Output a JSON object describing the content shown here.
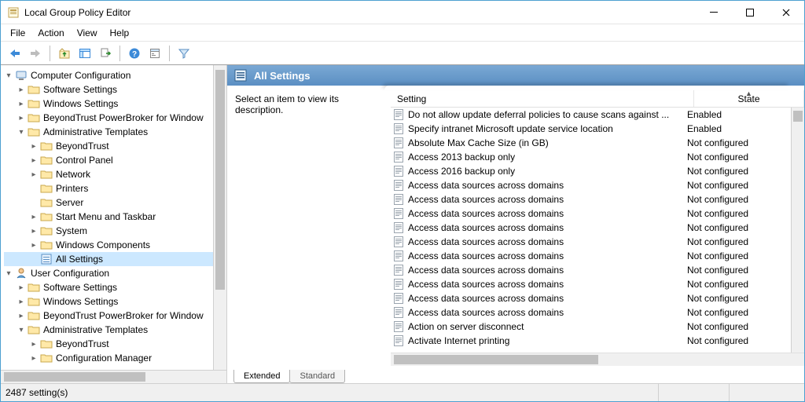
{
  "window": {
    "title": "Local Group Policy Editor"
  },
  "menu": {
    "file": "File",
    "action": "Action",
    "view": "View",
    "help": "Help"
  },
  "pane": {
    "title": "All Settings",
    "description_prompt": "Select an item to view its description."
  },
  "columns": {
    "setting": "Setting",
    "state": "State"
  },
  "tabs": {
    "extended": "Extended",
    "standard": "Standard"
  },
  "status": {
    "count": "2487 setting(s)"
  },
  "tree": {
    "cc": "Computer Configuration",
    "cc_children": {
      "software": "Software Settings",
      "windows": "Windows Settings",
      "beyondtrust_pb": "BeyondTrust PowerBroker for Window",
      "admin": "Administrative Templates",
      "admin_children": {
        "beyondtrust": "BeyondTrust",
        "control_panel": "Control Panel",
        "network": "Network",
        "printers": "Printers",
        "server": "Server",
        "startmenu": "Start Menu and Taskbar",
        "system": "System",
        "wincomp": "Windows Components",
        "allsettings": "All Settings"
      }
    },
    "uc": "User Configuration",
    "uc_children": {
      "software": "Software Settings",
      "windows": "Windows Settings",
      "beyondtrust_pb": "BeyondTrust PowerBroker for Window",
      "admin": "Administrative Templates",
      "admin_children": {
        "beyondtrust": "BeyondTrust",
        "confmgr": "Configuration Manager"
      }
    }
  },
  "list": [
    {
      "name": "Do not allow update deferral policies to cause scans against ...",
      "state": "Enabled"
    },
    {
      "name": "Specify intranet Microsoft update service location",
      "state": "Enabled"
    },
    {
      "name": "Absolute Max Cache Size (in GB)",
      "state": "Not configured"
    },
    {
      "name": "Access 2013 backup only",
      "state": "Not configured"
    },
    {
      "name": "Access 2016 backup only",
      "state": "Not configured"
    },
    {
      "name": "Access data sources across domains",
      "state": "Not configured"
    },
    {
      "name": "Access data sources across domains",
      "state": "Not configured"
    },
    {
      "name": "Access data sources across domains",
      "state": "Not configured"
    },
    {
      "name": "Access data sources across domains",
      "state": "Not configured"
    },
    {
      "name": "Access data sources across domains",
      "state": "Not configured"
    },
    {
      "name": "Access data sources across domains",
      "state": "Not configured"
    },
    {
      "name": "Access data sources across domains",
      "state": "Not configured"
    },
    {
      "name": "Access data sources across domains",
      "state": "Not configured"
    },
    {
      "name": "Access data sources across domains",
      "state": "Not configured"
    },
    {
      "name": "Access data sources across domains",
      "state": "Not configured"
    },
    {
      "name": "Action on server disconnect",
      "state": "Not configured"
    },
    {
      "name": "Activate Internet printing",
      "state": "Not configured"
    }
  ]
}
